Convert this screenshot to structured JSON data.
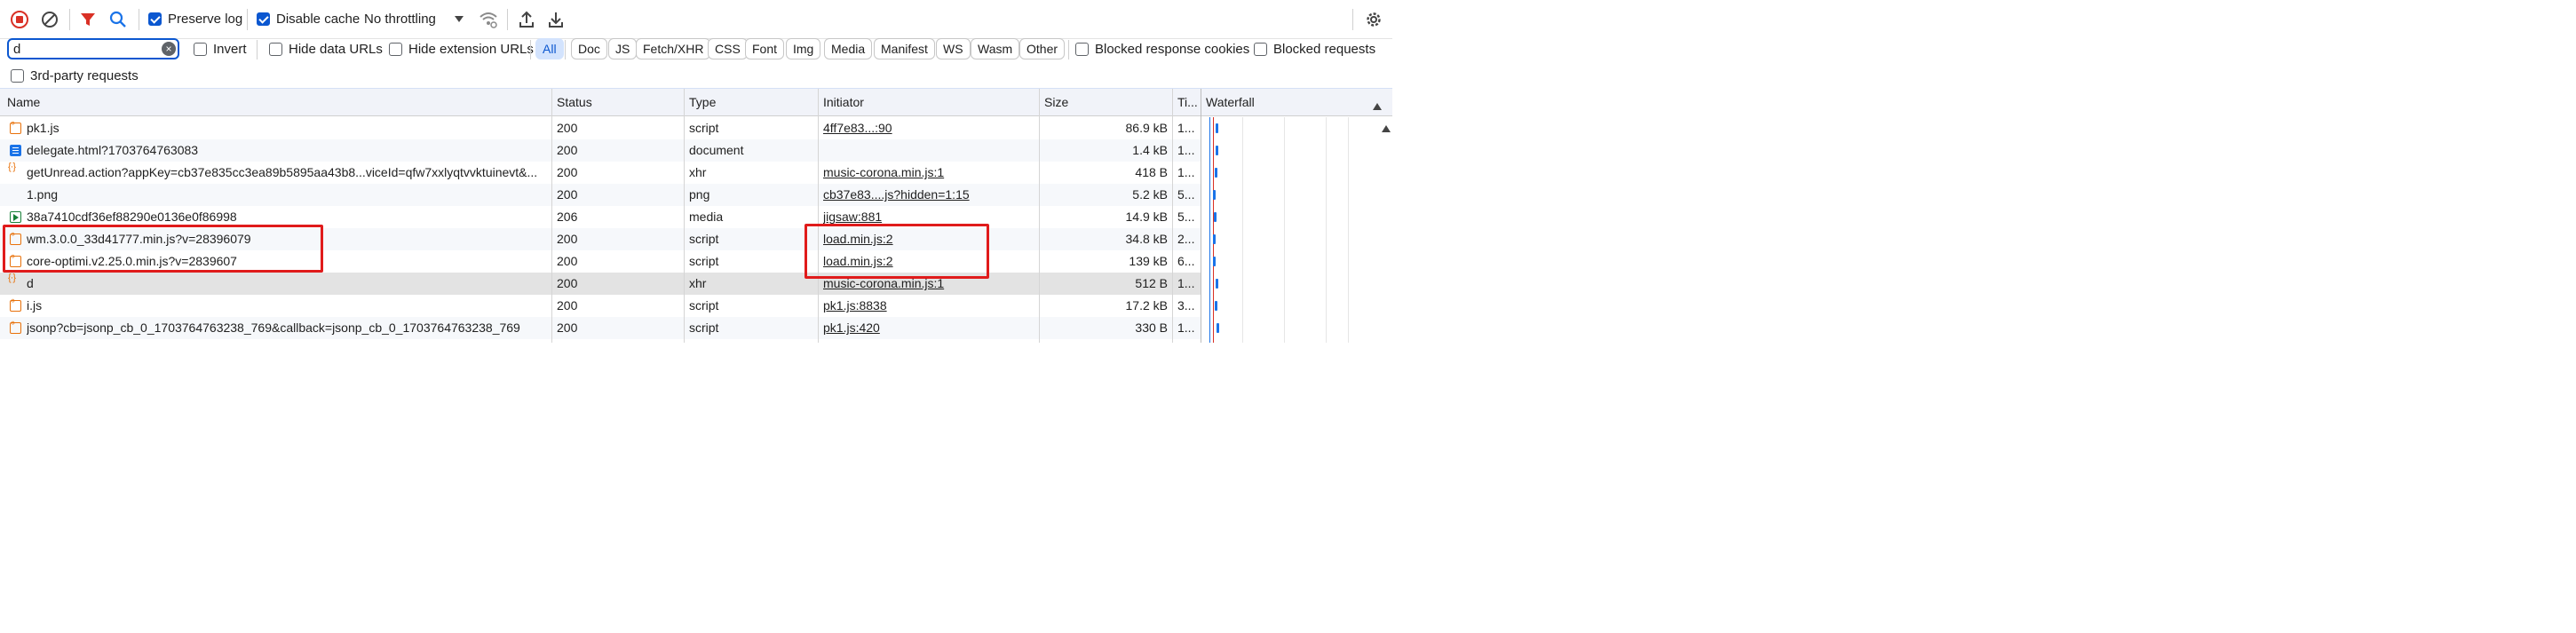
{
  "toolbar": {
    "record_icon": "record-stop-icon",
    "clear_icon": "clear-icon",
    "filter_icon": "funnel-icon",
    "search_icon": "search-icon",
    "preserve_log": {
      "label": "Preserve log",
      "checked": true
    },
    "disable_cache": {
      "label": "Disable cache",
      "checked": true
    },
    "throttling": "No throttling",
    "network_conditions_icon": "wifi-settings-icon",
    "import_icon": "upload-icon",
    "export_icon": "download-icon",
    "settings_icon": "gear-icon"
  },
  "filter": {
    "value": "d",
    "invert": {
      "label": "Invert",
      "checked": false
    },
    "hide_data_urls": {
      "label": "Hide data URLs",
      "checked": false
    },
    "hide_extension_urls": {
      "label": "Hide extension URLs",
      "checked": false
    },
    "types": [
      "All",
      "Doc",
      "JS",
      "Fetch/XHR",
      "CSS",
      "Font",
      "Img",
      "Media",
      "Manifest",
      "WS",
      "Wasm",
      "Other"
    ],
    "active_type": "All",
    "blocked_response_cookies": {
      "label": "Blocked response cookies",
      "checked": false
    },
    "blocked_requests": {
      "label": "Blocked requests",
      "checked": false
    },
    "third_party": {
      "label": "3rd-party requests",
      "checked": false
    }
  },
  "columns": {
    "name": "Name",
    "status": "Status",
    "type": "Type",
    "initiator": "Initiator",
    "size": "Size",
    "time": "Ti...",
    "waterfall": "Waterfall"
  },
  "rows": [
    {
      "icon": "script",
      "name": "pk1.js",
      "status": "200",
      "type": "script",
      "initiator": "4ff7e83...:90",
      "size": "86.9 kB",
      "time": "1..."
    },
    {
      "icon": "doc",
      "name": "delegate.html?1703764763083",
      "status": "200",
      "type": "document",
      "initiator": "",
      "size": "1.4 kB",
      "time": "1..."
    },
    {
      "icon": "xhr",
      "name": "getUnread.action?appKey=cb37e835cc3ea89b5895aa43b8...viceId=qfw7xxlyqtvvktuinevt&...",
      "status": "200",
      "type": "xhr",
      "initiator": "music-corona.min.js:1",
      "size": "418 B",
      "time": "1..."
    },
    {
      "icon": "none",
      "name": "1.png",
      "status": "200",
      "type": "png",
      "initiator": "cb37e83....js?hidden=1:15",
      "size": "5.2 kB",
      "time": "5..."
    },
    {
      "icon": "media",
      "name": "38a7410cdf36ef88290e0136e0f86998",
      "status": "206",
      "type": "media",
      "initiator": "jigsaw:881",
      "size": "14.9 kB",
      "time": "5..."
    },
    {
      "icon": "script",
      "name": "wm.3.0.0_33d41777.min.js?v=28396079",
      "status": "200",
      "type": "script",
      "initiator": "load.min.js:2",
      "size": "34.8 kB",
      "time": "2..."
    },
    {
      "icon": "script",
      "name": "core-optimi.v2.25.0.min.js?v=2839607",
      "status": "200",
      "type": "script",
      "initiator": "load.min.js:2",
      "size": "139 kB",
      "time": "6..."
    },
    {
      "icon": "xhr",
      "name": "d",
      "status": "200",
      "type": "xhr",
      "initiator": "music-corona.min.js:1",
      "size": "512 B",
      "time": "1..."
    },
    {
      "icon": "script",
      "name": "i.js",
      "status": "200",
      "type": "script",
      "initiator": "pk1.js:8838",
      "size": "17.2 kB",
      "time": "3..."
    },
    {
      "icon": "script",
      "name": "jsonp?cb=jsonp_cb_0_1703764763238_769&callback=jsonp_cb_0_1703764763238_769",
      "status": "200",
      "type": "script",
      "initiator": "pk1.js:420",
      "size": "330 B",
      "time": "1..."
    }
  ],
  "colors": {
    "accent": "#0b57d0",
    "record_red": "#d93025",
    "annotation_red": "#e01b1b",
    "selected_row": "#e3e3e3"
  }
}
